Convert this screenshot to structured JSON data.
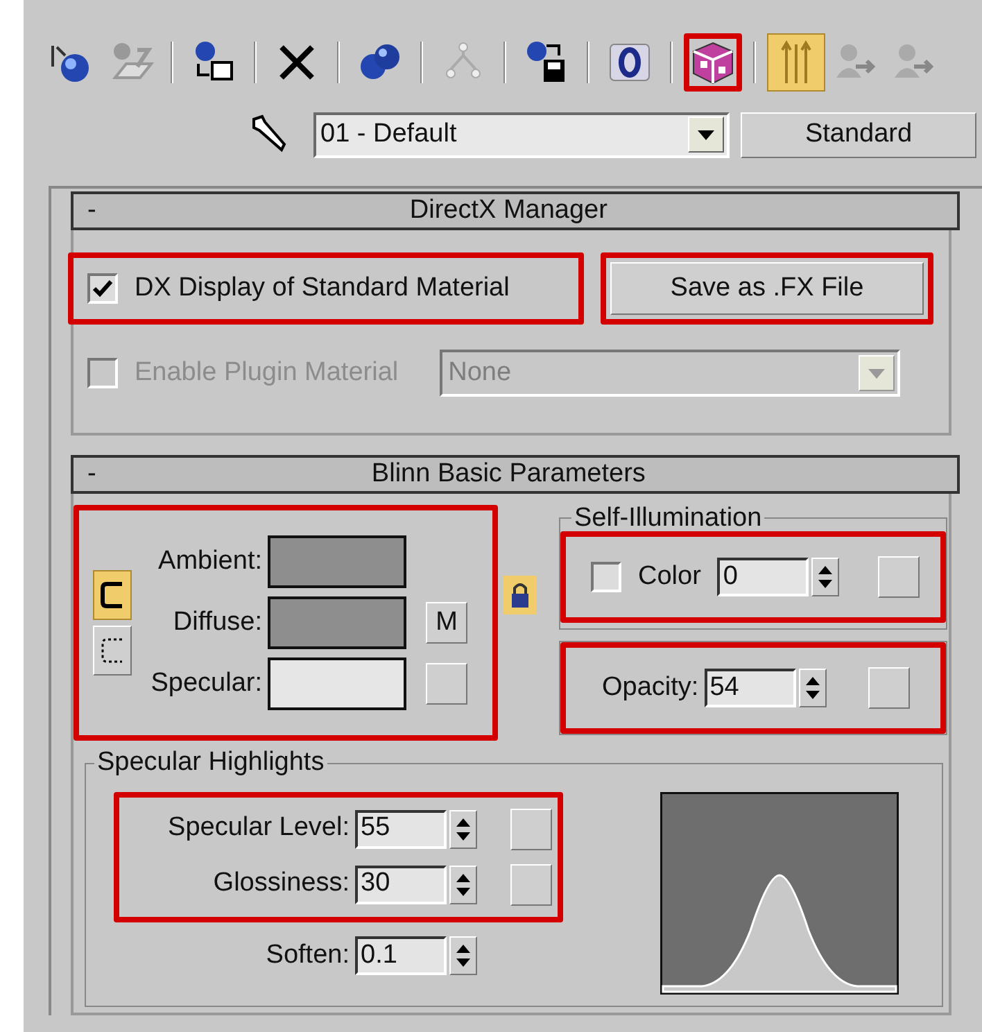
{
  "toolbar": {
    "groups": [
      [
        {
          "kind": "sphere-arrow",
          "highlighted": false,
          "active": false
        },
        {
          "kind": "sheet-arrow",
          "highlighted": false,
          "active": false
        }
      ],
      [
        {
          "kind": "sphere-box",
          "highlighted": false,
          "active": false
        }
      ],
      [
        {
          "kind": "cross",
          "highlighted": false,
          "active": false
        }
      ],
      [
        {
          "kind": "two-spheres",
          "highlighted": false,
          "active": false
        }
      ],
      [
        {
          "kind": "tree",
          "highlighted": false,
          "active": false
        }
      ],
      [
        {
          "kind": "sphere-disk",
          "highlighted": false,
          "active": false
        }
      ],
      [
        {
          "kind": "zero",
          "highlighted": false,
          "active": false
        }
      ],
      [
        {
          "kind": "checker-cube",
          "highlighted": true,
          "active": false
        }
      ],
      [
        {
          "kind": "arrows-up",
          "highlighted": false,
          "active": true
        },
        {
          "kind": "person-arrow",
          "highlighted": false,
          "active": false
        },
        {
          "kind": "person-arrow",
          "highlighted": false,
          "active": false
        }
      ]
    ]
  },
  "material": {
    "name": "01 - Default",
    "type_button": "Standard"
  },
  "directx": {
    "title": "DirectX Manager",
    "collapse": "-",
    "dx_display": {
      "label": "DX Display of Standard Material",
      "checked": true,
      "highlighted": true
    },
    "save_button": {
      "label": "Save as .FX File",
      "highlighted": true
    },
    "plugin": {
      "label": "Enable Plugin Material",
      "checked": false,
      "disabled": true,
      "value": "None"
    }
  },
  "blinn": {
    "title": "Blinn Basic Parameters",
    "collapse": "-",
    "colors": {
      "highlighted": true,
      "map_button": "M",
      "rows": [
        {
          "label": "Ambient:",
          "color": "#8e8e8e"
        },
        {
          "label": "Diffuse:",
          "color": "#8e8e8e"
        },
        {
          "label": "Specular:",
          "color": "#e6e6e6"
        }
      ]
    },
    "self_illumination": {
      "title": "Self-Illumination",
      "label": "Color",
      "checked": false,
      "value": "0",
      "highlighted": true
    },
    "opacity": {
      "label": "Opacity:",
      "value": "54",
      "highlighted": true
    }
  },
  "specular_highlights": {
    "title": "Specular Highlights",
    "fields": [
      {
        "label": "Specular Level:",
        "value": "55",
        "highlighted": true
      },
      {
        "label": "Glossiness:",
        "value": "30",
        "highlighted": true
      },
      {
        "label": "Soften:",
        "value": "0.1",
        "highlighted": false
      }
    ]
  }
}
